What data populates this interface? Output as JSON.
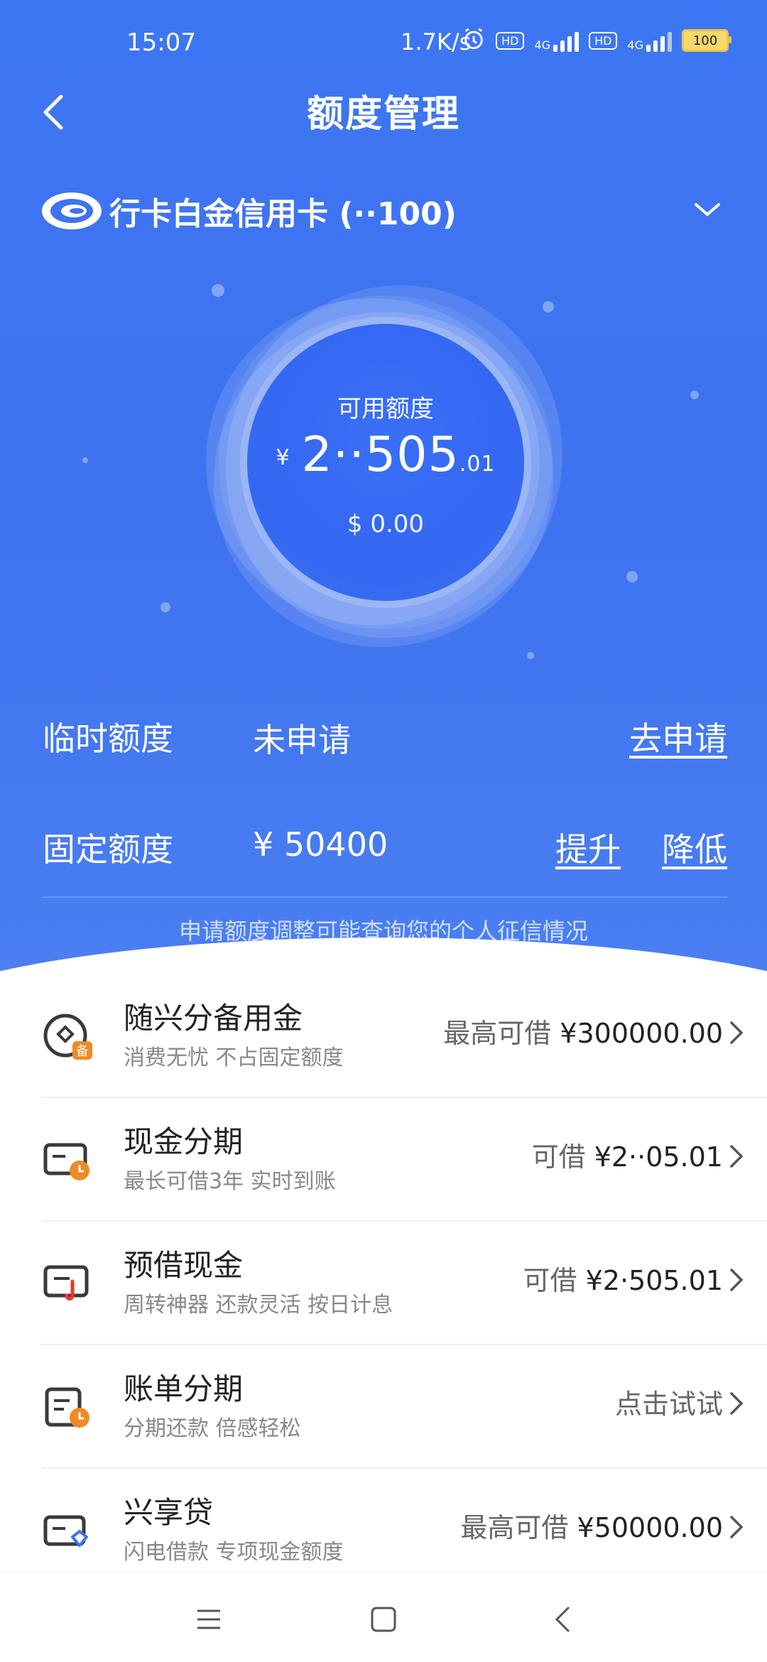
{
  "status": {
    "time": "15:07",
    "net_speed": "1.7K/s",
    "hd1": "HD",
    "sig1": "4G",
    "hd2": "HD",
    "sig2": "4G",
    "battery": "100"
  },
  "header": {
    "title": "额度管理"
  },
  "card": {
    "name": "行卡白金信用卡 (··100)"
  },
  "available": {
    "label": "可用额度",
    "currency": "¥",
    "amount": "2··505",
    "decimal": ".01",
    "usd": "$ 0.00"
  },
  "limits": {
    "temp_label": "临时额度",
    "temp_value": "未申请",
    "temp_action": "去申请",
    "fixed_label": "固定额度",
    "fixed_value": "¥ 50400",
    "raise": "提升",
    "lower": "降低"
  },
  "hint": "申请额度调整可能查询您的个人征信情况",
  "products": [
    {
      "title": "随兴分备用金",
      "subtitle": "消费无忧 不占固定额度",
      "right_prefix": "最高可借",
      "right_value": "¥300000.00",
      "icon": "standby-fund-icon"
    },
    {
      "title": "现金分期",
      "subtitle": "最长可借3年 实时到账",
      "right_prefix": "可借",
      "right_value": "¥2··05.01",
      "icon": "cash-installment-icon"
    },
    {
      "title": "预借现金",
      "subtitle": "周转神器 还款灵活 按日计息",
      "right_prefix": "可借",
      "right_value": "¥2·505.01",
      "icon": "cash-advance-icon"
    },
    {
      "title": "账单分期",
      "subtitle": "分期还款 倍感轻松",
      "right_prefix": "",
      "right_value": "点击试试",
      "icon": "bill-installment-icon"
    },
    {
      "title": "兴享贷",
      "subtitle": "闪电借款 专项现金额度",
      "right_prefix": "最高可借",
      "right_value": "¥50000.00",
      "icon": "loan-icon"
    }
  ],
  "colors": {
    "primary_blue": "#3f72ef",
    "accent_orange": "#f08a24"
  }
}
